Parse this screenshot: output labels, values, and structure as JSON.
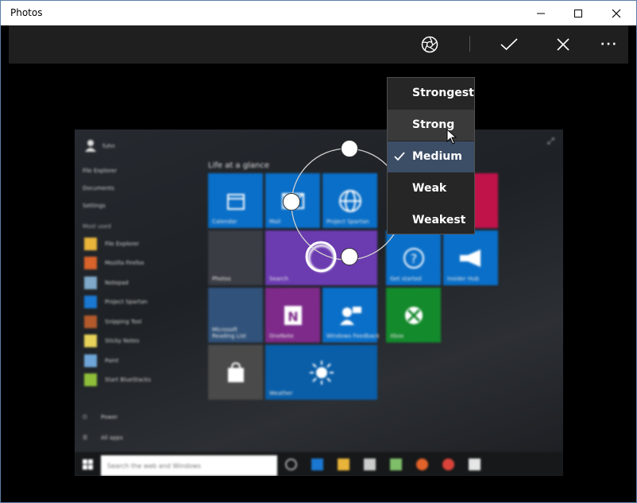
{
  "window": {
    "title": "Photos"
  },
  "toolbar": {
    "filter_icon": "aperture-icon",
    "apply_icon": "checkmark-icon",
    "cancel_icon": "close-icon",
    "more_label": "···"
  },
  "strength_menu": {
    "items": [
      "Strongest",
      "Strong",
      "Medium",
      "Weak",
      "Weakest"
    ],
    "selected": "Medium",
    "hovered": "Strong"
  },
  "photo": {
    "user": "fuhn",
    "left_links": [
      "File Explorer",
      "Documents",
      "Settings"
    ],
    "most_used_header": "Most used",
    "apps": [
      "File Explorer",
      "Mozilla Firefox",
      "Notepad",
      "Project Spartan",
      "Snipping Tool",
      "Sticky Notes",
      "Paint",
      "Start BlueStacks"
    ],
    "power": "Power",
    "all_apps": "All apps",
    "glance_header": "Life at a glance",
    "tiles": [
      "Calendar",
      "Mail",
      "Project Spartan",
      "Photos",
      "Search",
      "Get started",
      "Insider Hub",
      "Microsoft Reading List",
      "OneNote",
      "Windows Feedback",
      "Xbox",
      "Store",
      "Weather"
    ],
    "search_placeholder": "Search the web and Windows"
  },
  "colors": {
    "tile_blue": "#0a6fc8",
    "tile_purple": "#6b3bb0",
    "tile_green": "#138a2c",
    "tile_onenote": "#7d2a8a",
    "tile_gray": "#4a4a4a",
    "tile_red": "#c0134a",
    "menu_selected": "#3c4d66"
  }
}
